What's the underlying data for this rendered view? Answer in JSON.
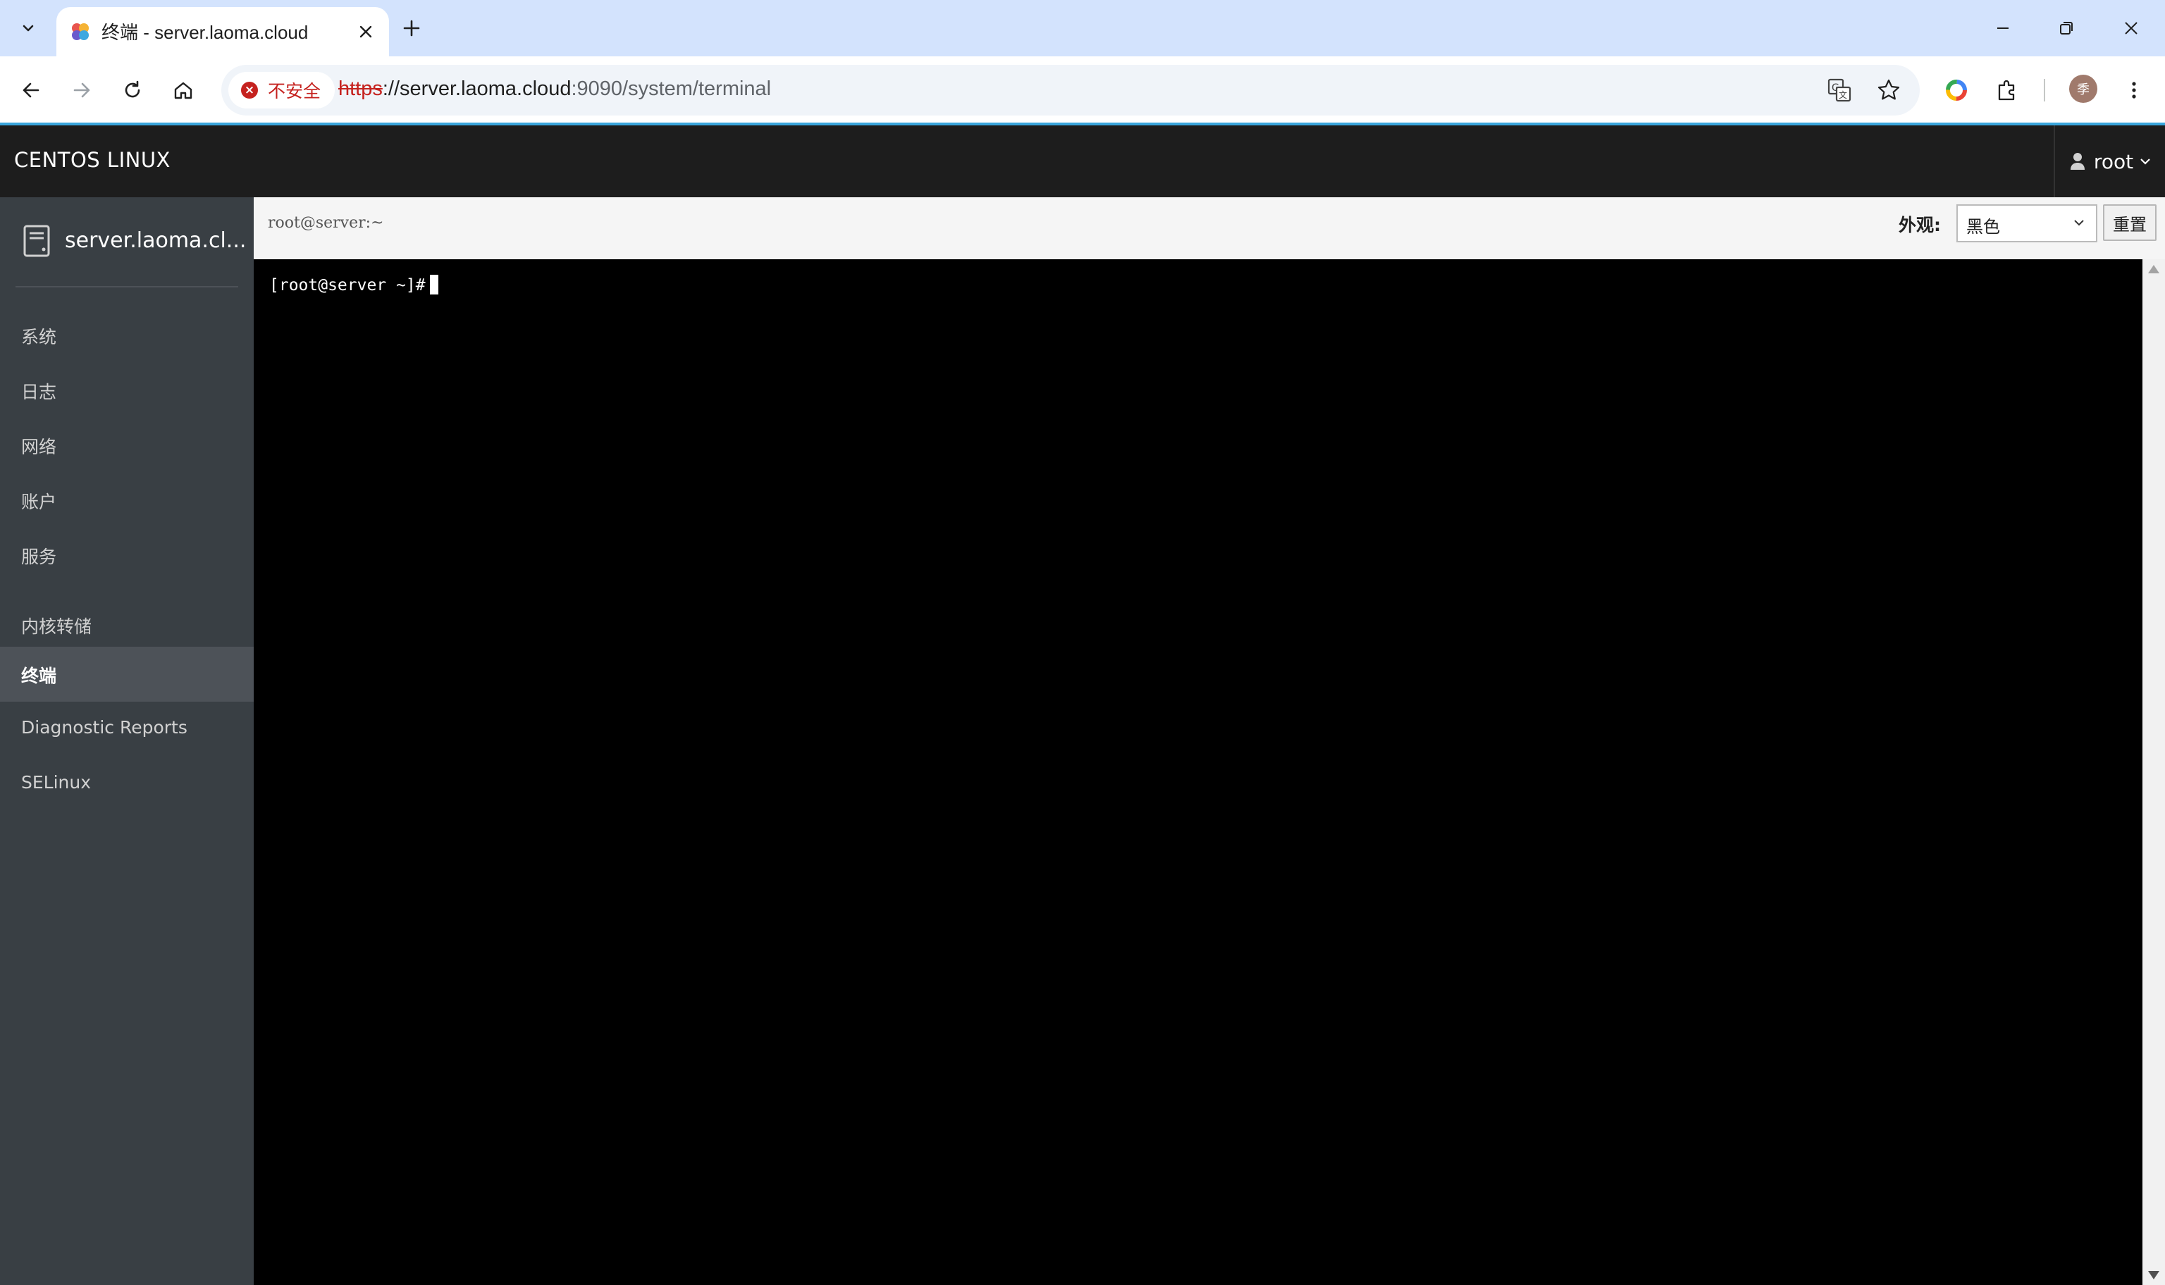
{
  "browser": {
    "tab_title": "终端 - server.laoma.cloud",
    "security_chip": "不安全",
    "url_scheme": "https",
    "url_host": "://server.laoma.cloud",
    "url_rest": ":9090/system/terminal",
    "profile_initial": "季"
  },
  "app": {
    "brand": "CENTOS LINUX",
    "user": "root"
  },
  "sidebar": {
    "host": "server.laoma.cl...",
    "items": [
      {
        "label": "系统"
      },
      {
        "label": "日志"
      },
      {
        "label": "网络"
      },
      {
        "label": "账户"
      },
      {
        "label": "服务"
      },
      {
        "label": "内核转储"
      },
      {
        "label": "终端"
      },
      {
        "label": "Diagnostic Reports"
      },
      {
        "label": "SELinux"
      }
    ],
    "active": "终端"
  },
  "terminal": {
    "title": "root@server:~",
    "appearance_label": "外观:",
    "theme_value": "黑色",
    "reset_label": "重置",
    "prompt": "[root@server ~]#"
  },
  "colors": {
    "accent": "#39a5dc",
    "sidebar_bg": "#393f44",
    "header_bg": "#1d1d1d",
    "terminal_bg": "#000000",
    "insecure": "#c5221f"
  }
}
